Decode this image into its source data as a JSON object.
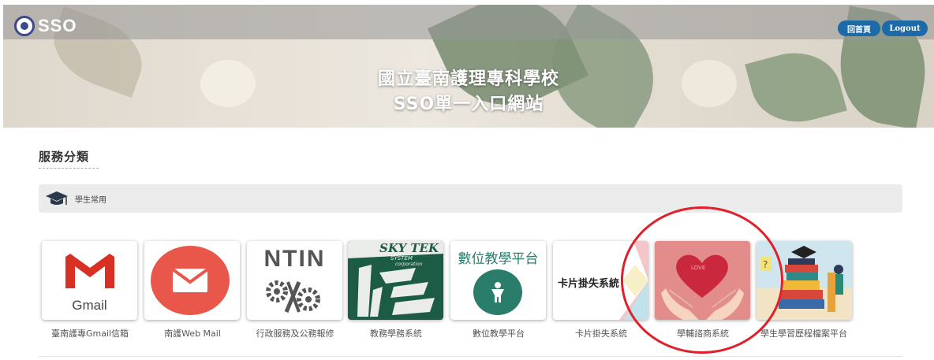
{
  "header": {
    "logo_text": "SSO",
    "home_button": "回首頁",
    "logout_button": "Logout",
    "title_line1": "國立臺南護理專科學校",
    "title_line2": "SSO單一入口網站"
  },
  "section": {
    "title": "服務分類",
    "category_label": "學生常用"
  },
  "services": [
    {
      "label": "臺南護專Gmail信箱",
      "icon": "gmail-icon",
      "icon_text": "Gmail"
    },
    {
      "label": "南護Web Mail",
      "icon": "envelope-icon"
    },
    {
      "label": "行政服務及公務報修",
      "icon": "gears-tools-icon",
      "icon_text": "NTIN"
    },
    {
      "label": "教務學務系統",
      "icon": "skytek-icon",
      "icon_text": "SKY TEK",
      "icon_subtext": "SYSTEM",
      "icon_subtext2": "corporation"
    },
    {
      "label": "數位教學平台",
      "icon": "digital-platform-icon",
      "icon_text": "數位教學平台"
    },
    {
      "label": "卡片掛失系統",
      "icon": "card-loss-icon",
      "icon_text": "卡片掛失系統"
    },
    {
      "label": "學輔諮商系統",
      "icon": "heart-hands-icon",
      "icon_text": "LOVE"
    },
    {
      "label": "學生學習歷程檔案平台",
      "icon": "learning-portfolio-icon"
    }
  ],
  "colors": {
    "button_blue": "#1d6aa8",
    "highlight_circle": "#e0202a",
    "gmail_red": "#d93025",
    "mail_red": "#e8574a",
    "skytek_green": "#1d5c44",
    "platform_teal": "#2a7d6b"
  }
}
